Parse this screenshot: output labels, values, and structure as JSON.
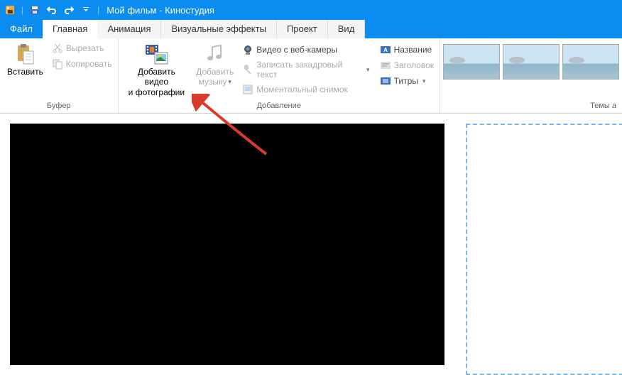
{
  "title": "Мой фильм - Киностудия",
  "tabs": {
    "file": "Файл",
    "home": "Главная",
    "animation": "Анимация",
    "effects": "Визуальные эффекты",
    "project": "Проект",
    "view": "Вид"
  },
  "ribbon": {
    "buffer": {
      "label": "Буфер",
      "paste": "Вставить",
      "cut": "Вырезать",
      "copy": "Копировать"
    },
    "add": {
      "label": "Добавление",
      "add_video_line1": "Добавить видео",
      "add_video_line2": "и фотографии",
      "add_music_line1": "Добавить",
      "add_music_line2": "музыку",
      "webcam": "Видео с веб-камеры",
      "narration": "Записать закадровый текст",
      "snapshot": "Моментальный снимок",
      "title": "Название",
      "header": "Заголовок",
      "credits": "Титры"
    },
    "themes": {
      "label": "Темы а"
    }
  }
}
